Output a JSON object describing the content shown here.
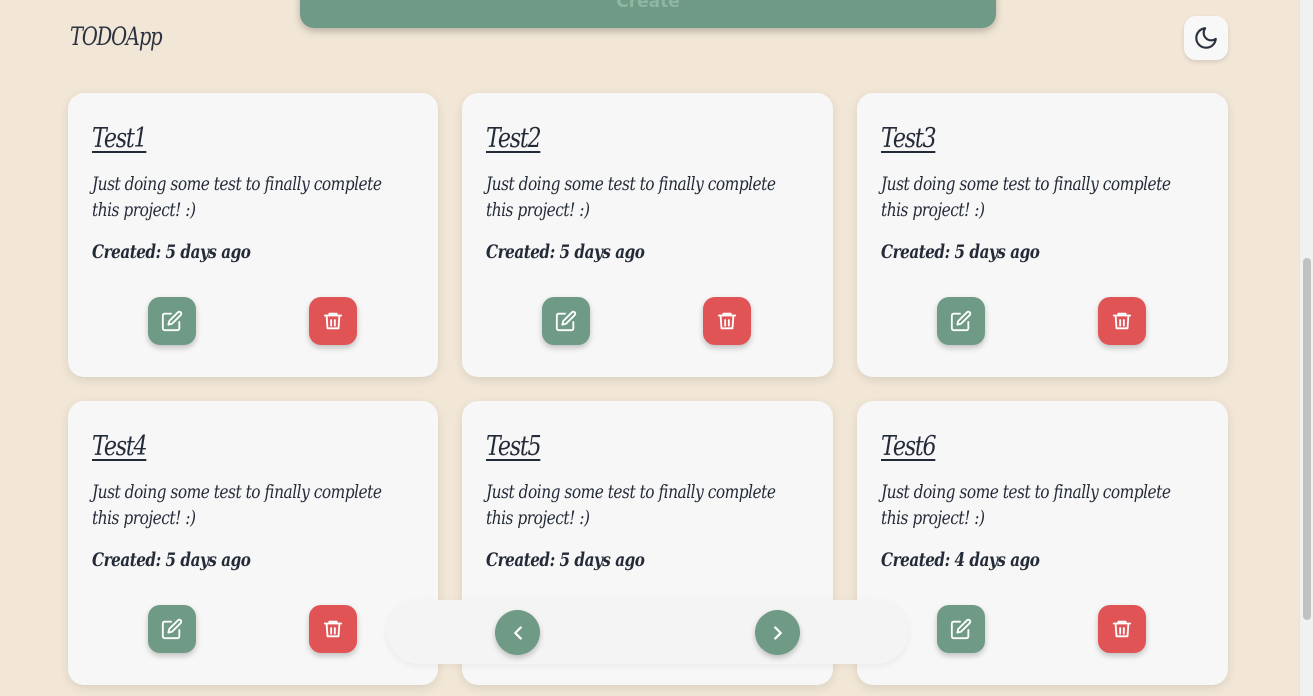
{
  "header": {
    "create_label": "Create",
    "logo": "TODOApp",
    "theme_icon": "moon-icon"
  },
  "cards": [
    {
      "title": "Test1",
      "description": "Just doing some test to finally complete this project! :)",
      "created": "Created: 5 days ago"
    },
    {
      "title": "Test2",
      "description": "Just doing some test to finally complete this project! :)",
      "created": "Created: 5 days ago"
    },
    {
      "title": "Test3",
      "description": "Just doing some test to finally complete this project! :)",
      "created": "Created: 5 days ago"
    },
    {
      "title": "Test4",
      "description": "Just doing some test to finally complete this project! :)",
      "created": "Created: 5 days ago"
    },
    {
      "title": "Test5",
      "description": "Just doing some test to finally complete this project! :)",
      "created": "Created: 5 days ago"
    },
    {
      "title": "Test6",
      "description": "Just doing some test to finally complete this project! :)",
      "created": "Created: 4 days ago"
    }
  ],
  "icons": {
    "edit": "edit-icon",
    "delete": "trash-icon",
    "prev": "chevron-left-icon",
    "next": "chevron-right-icon"
  },
  "colors": {
    "background": "#f2e7d7",
    "card": "#f7f7f7",
    "edit_button": "#6f9a85",
    "delete_button": "#e05456",
    "text": "#242b38"
  }
}
